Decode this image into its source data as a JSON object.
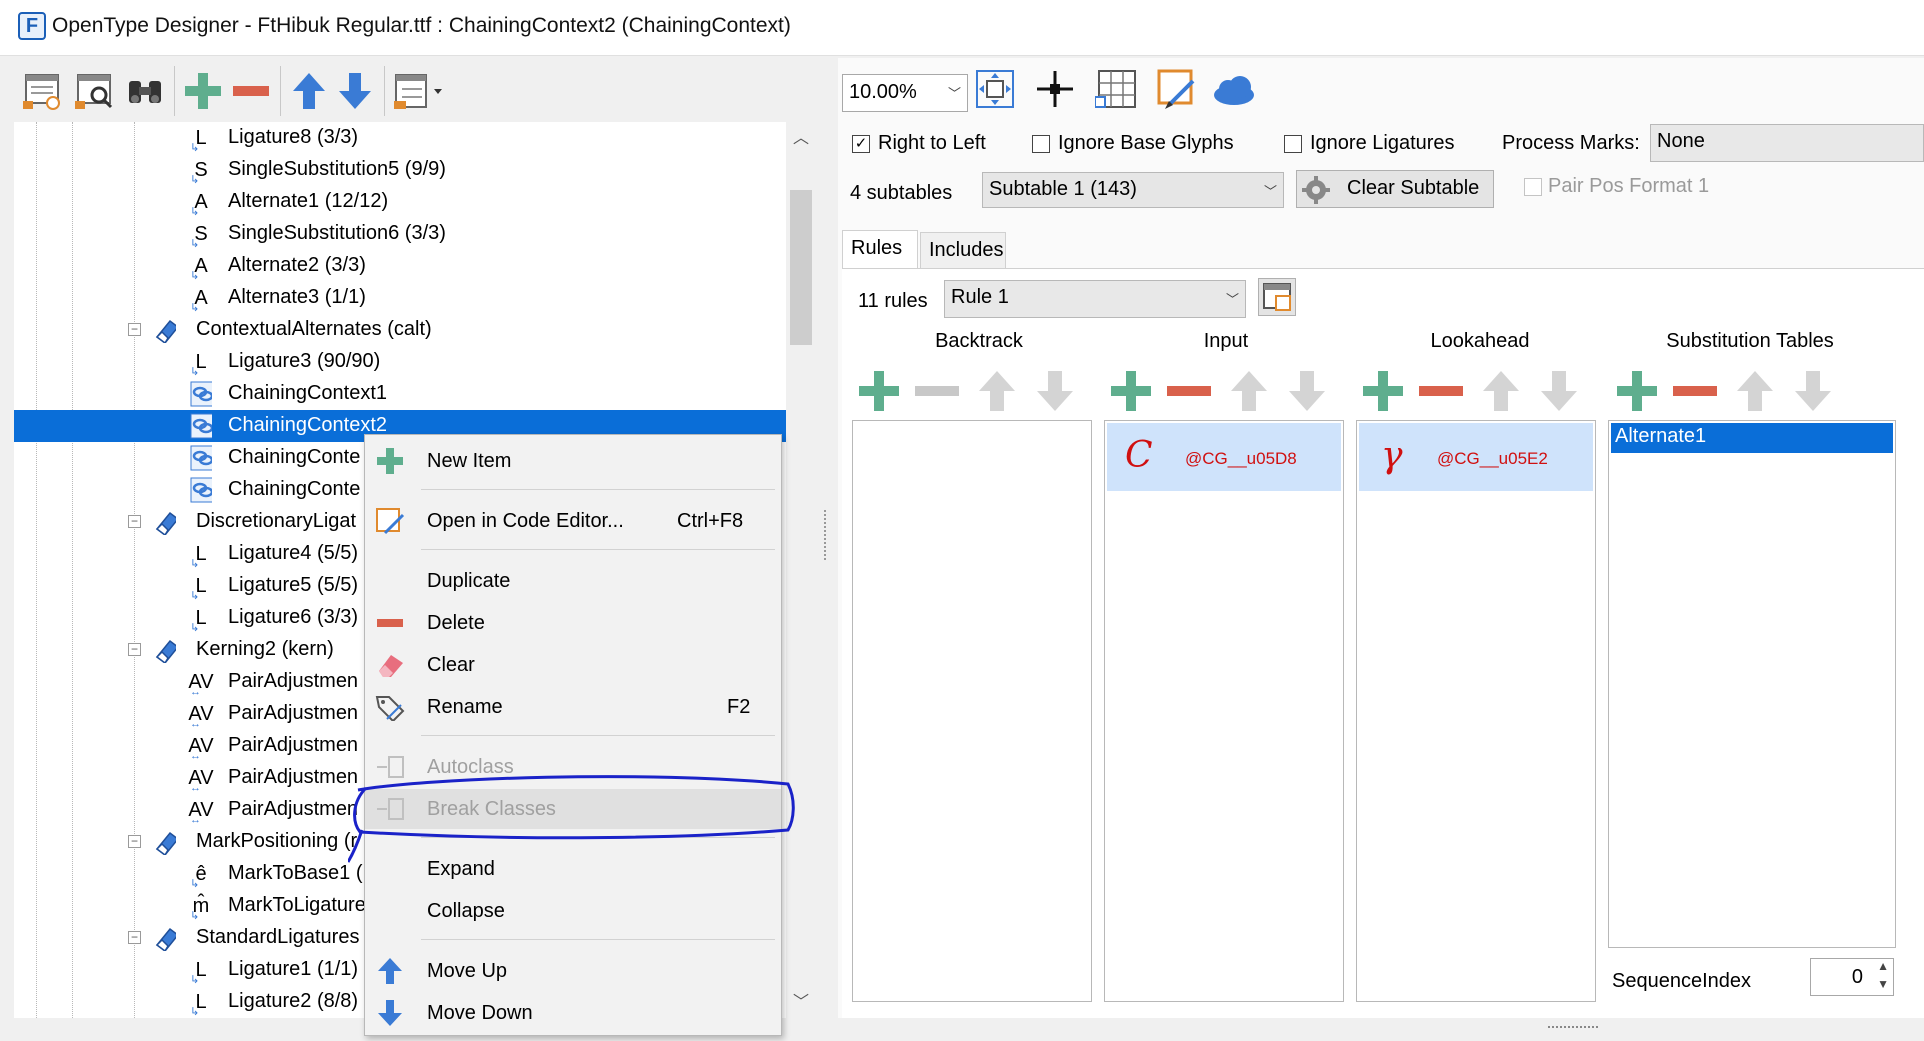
{
  "window": {
    "title": "OpenType Designer - FtHibuk Regular.ttf : ChainingContext2 (ChainingContext)",
    "logo_letter": "F"
  },
  "colors": {
    "accent": "#0a6ed8",
    "add_green": "#5fae8e",
    "remove_red": "#d9614c",
    "arrow_blue": "#3a7bd5",
    "glyph_red": "#d01010",
    "annotation_blue": "#1a22c8"
  },
  "left_toolbar": {
    "buttons": [
      "table-preview-icon",
      "table-search-icon",
      "binoculars-icon",
      "add-icon",
      "remove-icon",
      "move-up-icon",
      "move-down-icon",
      "view-options-icon"
    ]
  },
  "tree": {
    "items": [
      {
        "icon": "L",
        "label": "Ligature8 (3/3)"
      },
      {
        "icon": "S",
        "label": "SingleSubstitution5 (9/9)"
      },
      {
        "icon": "A",
        "label": "Alternate1 (12/12)"
      },
      {
        "icon": "S",
        "label": "SingleSubstitution6 (3/3)"
      },
      {
        "icon": "A",
        "label": "Alternate2 (3/3)"
      },
      {
        "icon": "A",
        "label": "Alternate3 (1/1)"
      },
      {
        "icon": "feature",
        "label": "ContextualAlternates (calt)"
      },
      {
        "icon": "L",
        "label": "Ligature3 (90/90)"
      },
      {
        "icon": "chain",
        "label": "ChainingContext1"
      },
      {
        "icon": "chain",
        "label": "ChainingContext2"
      },
      {
        "icon": "chain",
        "label": "ChainingConte"
      },
      {
        "icon": "chain",
        "label": "ChainingConte"
      },
      {
        "icon": "feature",
        "label": "DiscretionaryLigat"
      },
      {
        "icon": "L",
        "label": "Ligature4 (5/5)"
      },
      {
        "icon": "L",
        "label": "Ligature5 (5/5)"
      },
      {
        "icon": "L",
        "label": "Ligature6 (3/3)"
      },
      {
        "icon": "feature",
        "label": "Kerning2 (kern)"
      },
      {
        "icon": "AV",
        "label": "PairAdjustmen"
      },
      {
        "icon": "AV",
        "label": "PairAdjustmen"
      },
      {
        "icon": "AV",
        "label": "PairAdjustmen"
      },
      {
        "icon": "AV",
        "label": "PairAdjustmen"
      },
      {
        "icon": "AV",
        "label": "PairAdjustmen"
      },
      {
        "icon": "feature",
        "label": "MarkPositioning (r"
      },
      {
        "icon": "ê",
        "label": "MarkToBase1 ("
      },
      {
        "icon": "m̂",
        "label": "MarkToLigature"
      },
      {
        "icon": "feature",
        "label": "StandardLigatures"
      },
      {
        "icon": "L",
        "label": "Ligature1 (1/1)"
      },
      {
        "icon": "L",
        "label": "Ligature2 (8/8)"
      }
    ]
  },
  "context_menu": {
    "new_item": "New Item",
    "open_code_editor": "Open in Code Editor...",
    "open_code_editor_shortcut": "Ctrl+F8",
    "duplicate": "Duplicate",
    "delete": "Delete",
    "clear": "Clear",
    "rename": "Rename",
    "rename_shortcut": "F2",
    "autoclass": "Autoclass",
    "break_classes": "Break Classes",
    "expand": "Expand",
    "collapse": "Collapse",
    "move_up": "Move Up",
    "move_down": "Move Down"
  },
  "right_toolbar": {
    "zoom": "10.00%"
  },
  "options": {
    "right_to_left": "Right to Left",
    "right_to_left_checked": true,
    "ignore_base_glyphs": "Ignore Base Glyphs",
    "ignore_ligatures": "Ignore Ligatures",
    "process_marks_label": "Process Marks:",
    "process_marks_value": "None",
    "subtables_count": "4 subtables",
    "subtable_selected": "Subtable 1 (143)",
    "clear_subtable": "Clear Subtable",
    "pair_pos_format": "Pair Pos Format 1"
  },
  "tabs": {
    "rules": "Rules",
    "includes": "Includes"
  },
  "rules": {
    "count": "11 rules",
    "selected": "Rule 1",
    "columns": {
      "backtrack": "Backtrack",
      "input": "Input",
      "lookahead": "Lookahead",
      "substitution_tables": "Substitution Tables"
    },
    "input_item": {
      "glyph": "C",
      "name": "@CG__u05D8"
    },
    "lookahead_item": {
      "glyph": "γ",
      "name": "@CG__u05E2"
    },
    "substitution_item": "Alternate1",
    "sequence_index_label": "SequenceIndex",
    "sequence_index_value": "0"
  }
}
